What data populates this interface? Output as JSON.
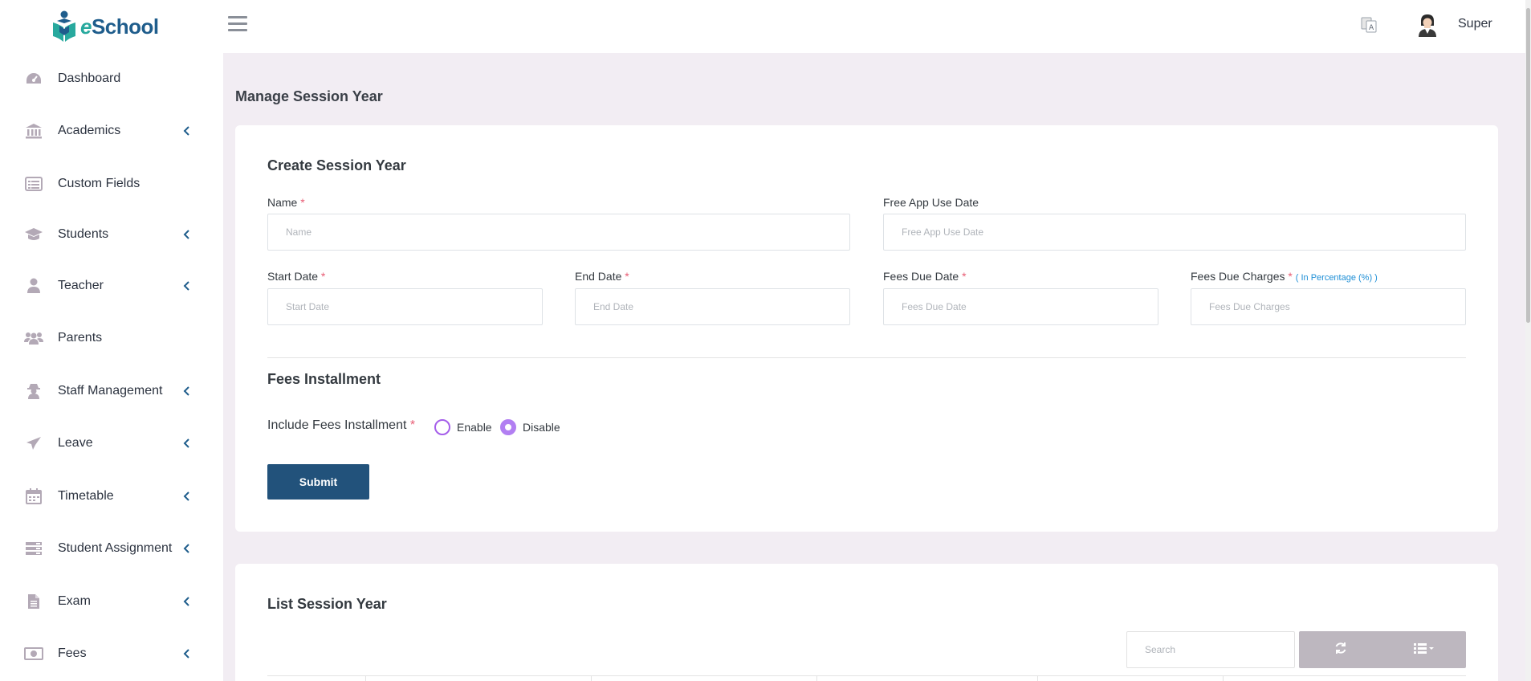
{
  "brand": {
    "name": "eSchool",
    "name_prefix": "e",
    "name_rest": "School"
  },
  "sidebar": {
    "items": [
      {
        "label": "Dashboard",
        "icon": "dashboard-icon",
        "has_submenu": false
      },
      {
        "label": "Academics",
        "icon": "bank-icon",
        "has_submenu": true
      },
      {
        "label": "Custom Fields",
        "icon": "list-icon",
        "has_submenu": false
      },
      {
        "label": "Students",
        "icon": "graduation-cap-icon",
        "has_submenu": true
      },
      {
        "label": "Teacher",
        "icon": "user-icon",
        "has_submenu": true
      },
      {
        "label": "Parents",
        "icon": "users-icon",
        "has_submenu": false
      },
      {
        "label": "Staff Management",
        "icon": "user-secret-icon",
        "has_submenu": true
      },
      {
        "label": "Leave",
        "icon": "plane-icon",
        "has_submenu": true
      },
      {
        "label": "Timetable",
        "icon": "calendar-icon",
        "has_submenu": true
      },
      {
        "label": "Student Assignment",
        "icon": "tasks-icon",
        "has_submenu": true
      },
      {
        "label": "Exam",
        "icon": "file-icon",
        "has_submenu": true
      },
      {
        "label": "Fees",
        "icon": "money-icon",
        "has_submenu": true
      }
    ]
  },
  "topbar": {
    "user_name": "Super",
    "language_icon": "language-icon",
    "menu_icon": "hamburger-icon"
  },
  "page": {
    "title": "Manage Session Year"
  },
  "create_form": {
    "title": "Create Session Year",
    "name": {
      "label": "Name",
      "required": "*",
      "placeholder": "Name"
    },
    "free_app_use_date": {
      "label": "Free App Use Date",
      "placeholder": "Free App Use Date"
    },
    "start_date": {
      "label": "Start Date",
      "required": "*",
      "placeholder": "Start Date"
    },
    "end_date": {
      "label": "End Date",
      "required": "*",
      "placeholder": "End Date"
    },
    "fees_due_date": {
      "label": "Fees Due Date",
      "required": "*",
      "placeholder": "Fees Due Date"
    },
    "fees_due_charges": {
      "label": "Fees Due Charges",
      "required": "*",
      "hint": "( In Percentage (%) )",
      "placeholder": "Fees Due Charges"
    },
    "installment_section_title": "Fees Installment",
    "include_installment": {
      "label": "Include Fees Installment",
      "required": "*",
      "options": [
        {
          "label": "Enable",
          "checked": false
        },
        {
          "label": "Disable",
          "checked": true
        }
      ]
    },
    "submit_label": "Submit"
  },
  "list": {
    "title": "List Session Year",
    "search_placeholder": "Search",
    "refresh_icon": "refresh-icon",
    "columns_icon": "columns-icon"
  },
  "colors": {
    "accent": "#22527b",
    "radio": "#a55eea",
    "background": "#f2edf3",
    "sidebar_icon": "#b3a9b6",
    "chevron": "#1f5d8c"
  }
}
